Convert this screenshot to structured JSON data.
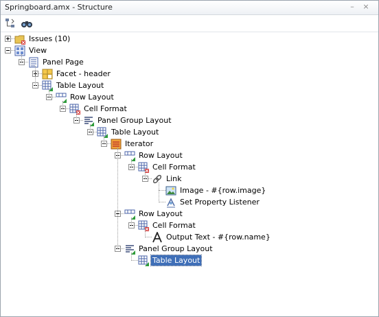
{
  "window": {
    "title": "Springboard.amx - Structure",
    "controls": {
      "minimize": "–",
      "close": "×"
    }
  },
  "toolbar": {
    "buttons": [
      {
        "icon": "hierarchy-icon"
      },
      {
        "icon": "binoculars-icon"
      }
    ]
  },
  "tree": {
    "nodes": [
      {
        "label": "Issues (10)",
        "icon": "folder-issues-icon",
        "toggle": "plus"
      },
      {
        "label": "View",
        "icon": "view-icon",
        "toggle": "minus"
      },
      {
        "label": "Panel Page",
        "icon": "page-icon",
        "toggle": "minus"
      },
      {
        "label": "Facet - header",
        "icon": "facet-icon",
        "toggle": "plus"
      },
      {
        "label": "Table Layout",
        "icon": "table-layout-icon",
        "toggle": "minus"
      },
      {
        "label": "Row Layout",
        "icon": "row-layout-icon",
        "toggle": "minus"
      },
      {
        "label": "Cell Format",
        "icon": "cell-format-icon",
        "toggle": "minus"
      },
      {
        "label": "Panel Group Layout",
        "icon": "panel-group-icon",
        "toggle": "minus"
      },
      {
        "label": "Table Layout",
        "icon": "table-layout-icon",
        "toggle": "minus"
      },
      {
        "label": "Iterator",
        "icon": "iterator-icon",
        "toggle": "minus"
      },
      {
        "label": "Row Layout",
        "icon": "row-layout-icon",
        "toggle": "minus"
      },
      {
        "label": "Cell Format",
        "icon": "cell-format-icon",
        "toggle": "minus"
      },
      {
        "label": "Link",
        "icon": "link-icon",
        "toggle": "minus"
      },
      {
        "label": "Image - #{row.image}",
        "icon": "image-icon",
        "toggle": "none"
      },
      {
        "label": "Set Property Listener",
        "icon": "listener-icon",
        "toggle": "none"
      },
      {
        "label": "Row Layout",
        "icon": "row-layout-icon",
        "toggle": "minus"
      },
      {
        "label": "Cell Format",
        "icon": "cell-format-icon",
        "toggle": "minus"
      },
      {
        "label": "Output Text - #{row.name}",
        "icon": "output-text-icon",
        "toggle": "none"
      },
      {
        "label": "Panel Group Layout",
        "icon": "panel-group-icon",
        "toggle": "minus"
      },
      {
        "label": "Table Layout",
        "icon": "table-layout-icon",
        "toggle": "none",
        "selected": true
      }
    ]
  },
  "colors": {
    "selection": "#3f6fb8",
    "folder": "#e8c455",
    "error_badge": "#d13030",
    "ok_badge": "#2e9b3a"
  }
}
